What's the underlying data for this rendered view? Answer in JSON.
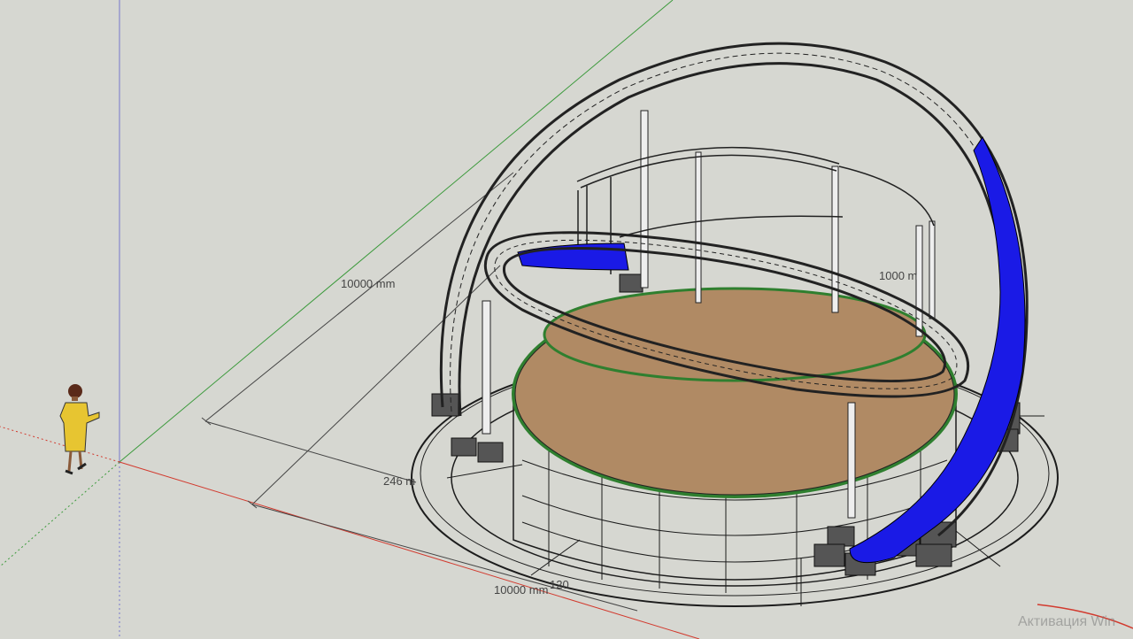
{
  "app": "SketchUp",
  "viewport": {
    "dimensions": {
      "main_width": "10000 mm",
      "main_depth": "10000 mm",
      "small_left": "246 m",
      "small_right": "1000 m",
      "small_bottom": "120"
    }
  },
  "overlay": {
    "activation_text": "Активация Win"
  },
  "colors": {
    "background": "#d6d7d1",
    "axis_red": "#d23a2e",
    "axis_green": "#3c9a3c",
    "axis_blue": "#5a5ad0",
    "stage_floor": "#b08a64",
    "panel_blue": "#1a1ae6",
    "truss": "#2a2a2a",
    "figure_dress": "#e7c531"
  }
}
